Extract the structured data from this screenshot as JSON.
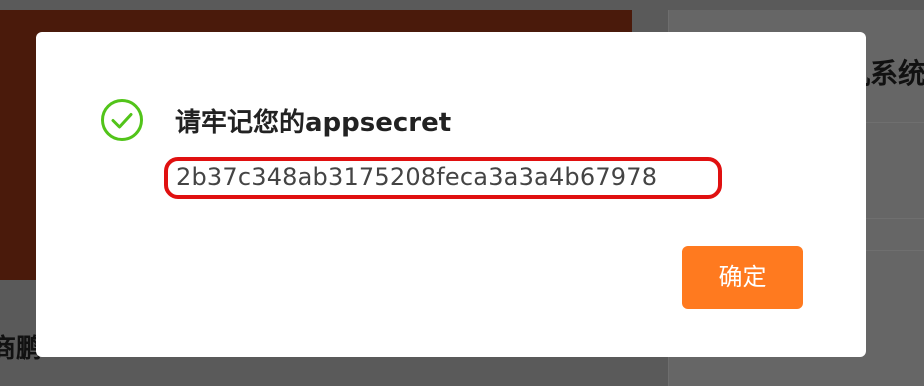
{
  "background": {
    "left_text": "商鹏",
    "right_title": "机系统"
  },
  "modal": {
    "icon": "check-circle-icon",
    "title": "请牢记您的appsecret",
    "secret": "2b37c348ab3175208feca3a3a4b67978",
    "confirm_label": "确定"
  },
  "colors": {
    "accent": "#ff7a1f",
    "success": "#52c41a",
    "highlight": "#e01010"
  }
}
